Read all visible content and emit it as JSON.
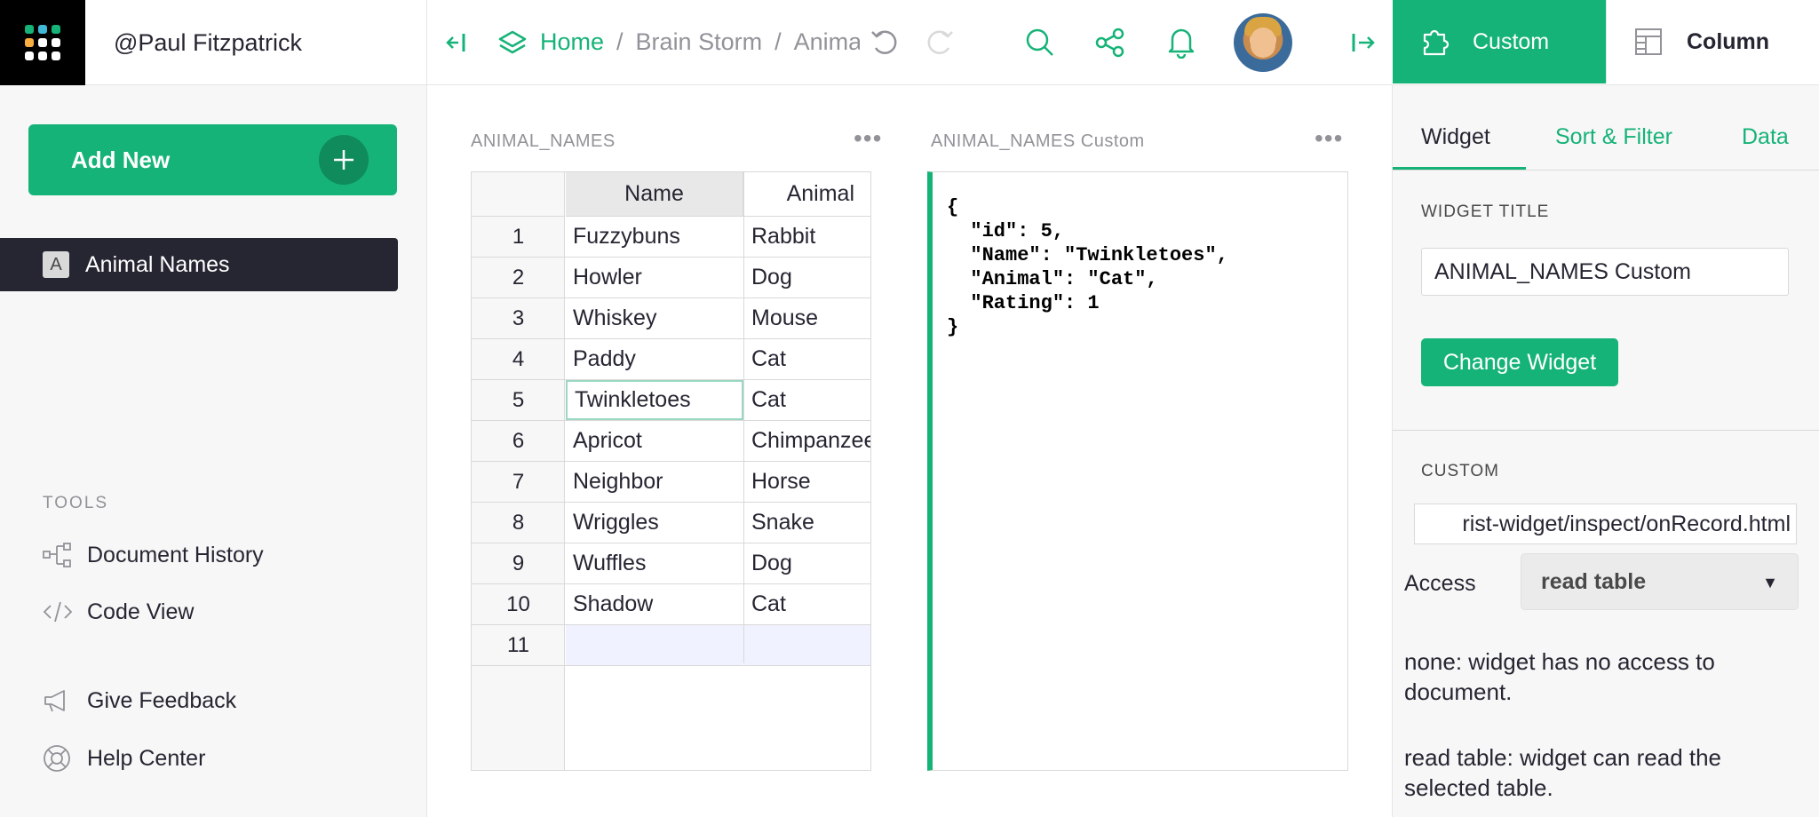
{
  "topbar": {
    "org_name": "@Paul Fitzpatrick",
    "breadcrumb": {
      "home": "Home",
      "sep1": "/",
      "doc": "Brain Storm",
      "sep2": "/",
      "page": "Anima"
    },
    "custom_tab": "Custom",
    "column_tab": "Column"
  },
  "left": {
    "add_new": "Add New",
    "pages": [
      {
        "icon_letter": "A",
        "label": "Animal Names"
      }
    ],
    "tools_label": "TOOLS",
    "tools": {
      "history": "Document History",
      "code": "Code View",
      "feedback": "Give Feedback",
      "help": "Help Center"
    }
  },
  "table_section": {
    "title": "ANIMAL_NAMES",
    "menu": "•••",
    "headers": {
      "name": "Name",
      "animal": "Animal"
    },
    "rows": [
      {
        "n": "1",
        "name": "Fuzzybuns",
        "animal": "Rabbit"
      },
      {
        "n": "2",
        "name": "Howler",
        "animal": "Dog"
      },
      {
        "n": "3",
        "name": "Whiskey",
        "animal": "Mouse"
      },
      {
        "n": "4",
        "name": "Paddy",
        "animal": "Cat"
      },
      {
        "n": "5",
        "name": "Twinkletoes",
        "animal": "Cat"
      },
      {
        "n": "6",
        "name": "Apricot",
        "animal": "Chimpanzee"
      },
      {
        "n": "7",
        "name": "Neighbor",
        "animal": "Horse"
      },
      {
        "n": "8",
        "name": "Wriggles",
        "animal": "Snake"
      },
      {
        "n": "9",
        "name": "Wuffles",
        "animal": "Dog"
      },
      {
        "n": "10",
        "name": "Shadow",
        "animal": "Cat"
      },
      {
        "n": "11",
        "name": "",
        "animal": ""
      }
    ],
    "selected_row": "5"
  },
  "custom_section": {
    "title": "ANIMAL_NAMES Custom",
    "menu": "•••",
    "json_text": "{\n  \"id\": 5,\n  \"Name\": \"Twinkletoes\",\n  \"Animal\": \"Cat\",\n  \"Rating\": 1\n}"
  },
  "right": {
    "tabs": {
      "widget": "Widget",
      "sort": "Sort & Filter",
      "data": "Data"
    },
    "widget_title_label": "WIDGET TITLE",
    "widget_title_value": "ANIMAL_NAMES Custom",
    "change_widget": "Change Widget",
    "custom_label": "CUSTOM",
    "url_value": "rist-widget/inspect/onRecord.html",
    "access_label": "Access",
    "access_value": "read table",
    "help_none": "none: widget has no access to document.",
    "help_read": "read table: widget can read the selected table."
  },
  "colors": {
    "accent": "#16b378",
    "dark": "#262633",
    "panel": "#f7f7f7"
  }
}
